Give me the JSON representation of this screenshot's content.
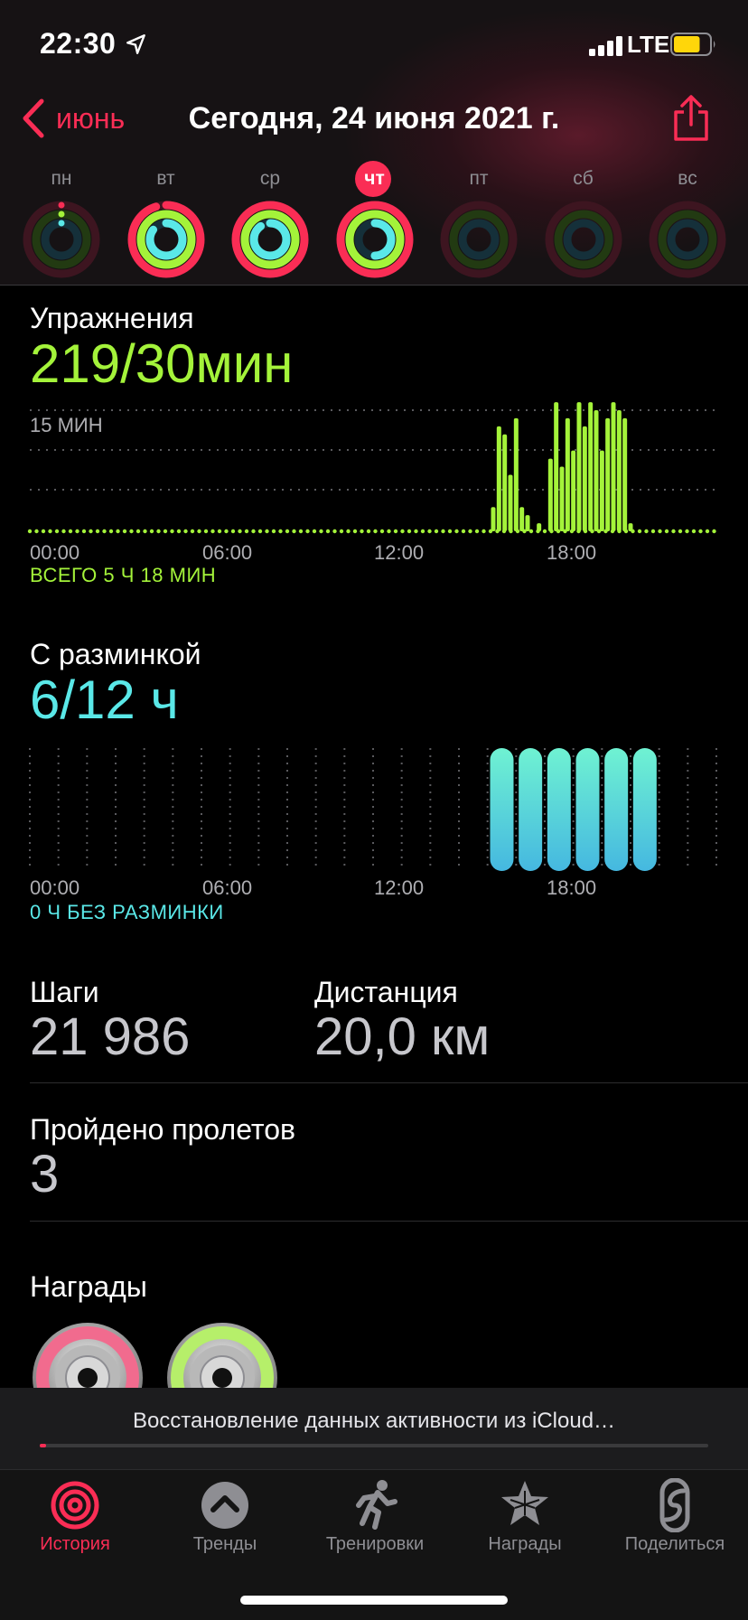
{
  "status": {
    "time": "22:30",
    "network": "LTE",
    "battery_percent": 75
  },
  "header": {
    "back_label": "июнь",
    "title": "Сегодня, 24 июня 2021 г."
  },
  "week": [
    {
      "label": "пн",
      "move": 0.0,
      "exercise": 0.0,
      "stand": 0.0,
      "today": false
    },
    {
      "label": "вт",
      "move": 0.95,
      "exercise": 1.0,
      "stand": 0.85,
      "today": false
    },
    {
      "label": "ср",
      "move": 1.0,
      "exercise": 1.0,
      "stand": 0.9,
      "today": false
    },
    {
      "label": "чт",
      "move": 1.0,
      "exercise": 1.0,
      "stand": 0.5,
      "today": true
    },
    {
      "label": "пт",
      "move": 0.0,
      "exercise": 0.0,
      "stand": 0.0,
      "today": false
    },
    {
      "label": "сб",
      "move": 0.0,
      "exercise": 0.0,
      "stand": 0.0,
      "today": false
    },
    {
      "label": "вс",
      "move": 0.0,
      "exercise": 0.0,
      "stand": 0.0,
      "today": false
    }
  ],
  "exercise": {
    "title": "Упражнения",
    "value": "219/30мин",
    "scale_label": "15 МИН",
    "ticks": [
      "00:00",
      "06:00",
      "12:00",
      "18:00"
    ],
    "total": "ВСЕГО 5 Ч 18 МИН"
  },
  "stand": {
    "title": "С разминкой",
    "value": "6/12 ч",
    "ticks": [
      "00:00",
      "06:00",
      "12:00",
      "18:00"
    ],
    "total": "0 Ч БЕЗ РАЗМИНКИ"
  },
  "stats": {
    "steps_label": "Шаги",
    "steps_value": "21 986",
    "distance_label": "Дистанция",
    "distance_value": "20,0 км",
    "flights_label": "Пройдено пролетов",
    "flights_value": "3"
  },
  "awards": {
    "title": "Награды"
  },
  "banner": {
    "text": "Восстановление данных активности из iCloud…",
    "progress": 0.01
  },
  "tabs": [
    {
      "label": "История",
      "icon": "history-rings-icon",
      "active": true
    },
    {
      "label": "Тренды",
      "icon": "trends-chevron-icon",
      "active": false
    },
    {
      "label": "Тренировки",
      "icon": "running-figure-icon",
      "active": false
    },
    {
      "label": "Награды",
      "icon": "awards-star-icon",
      "active": false
    },
    {
      "label": "Поделиться",
      "icon": "sharing-icon",
      "active": false
    }
  ],
  "colors": {
    "move": "#fa2d55",
    "exercise": "#a4f33a",
    "stand": "#5ae8e8",
    "accent": "#fa2d55"
  },
  "chart_data": [
    {
      "type": "bar",
      "title": "Упражнения",
      "x_unit": "hour",
      "ytick_label": "15 МИН",
      "ylim": [
        0,
        15
      ],
      "x": [
        16.2,
        16.4,
        16.6,
        16.8,
        17.0,
        17.2,
        17.4,
        17.6,
        17.8,
        18.2,
        18.4,
        18.6,
        18.8,
        19.0,
        19.2,
        19.4,
        19.6,
        19.8,
        20.0,
        20.2,
        20.4,
        20.6,
        20.8,
        21.0,
        21.2
      ],
      "values": [
        3,
        13,
        12,
        7,
        14,
        3,
        2,
        0,
        1,
        9,
        16,
        8,
        14,
        10,
        16,
        13,
        16,
        15,
        10,
        14,
        16,
        15,
        14,
        1,
        0
      ],
      "xticks": [
        "00:00",
        "06:00",
        "12:00",
        "18:00"
      ]
    },
    {
      "type": "bar",
      "title": "С разминкой",
      "x_unit": "hour",
      "categories": [
        "16",
        "17",
        "18",
        "19",
        "20",
        "21"
      ],
      "values": [
        1,
        1,
        1,
        1,
        1,
        1
      ],
      "xticks": [
        "00:00",
        "06:00",
        "12:00",
        "18:00"
      ]
    }
  ]
}
